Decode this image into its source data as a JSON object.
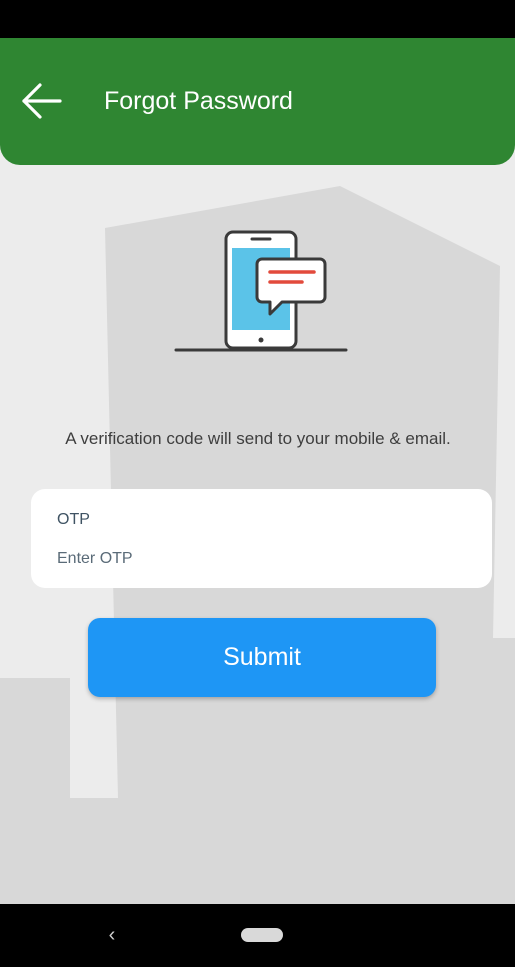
{
  "app_bar": {
    "title": "Forgot Password",
    "back_icon": "arrow-left-icon",
    "color": "#2f8632"
  },
  "illustration": {
    "icon": "phone-message-icon"
  },
  "info": {
    "text": "A verification code will send to your mobile & email."
  },
  "otp": {
    "label": "OTP",
    "placeholder": "Enter OTP",
    "value": ""
  },
  "submit": {
    "label": "Submit",
    "color": "#1e96f5"
  },
  "nav_bar": {
    "back_icon": "chevron-left-icon",
    "back_glyph": "‹",
    "home_icon": "home-pill-icon"
  }
}
